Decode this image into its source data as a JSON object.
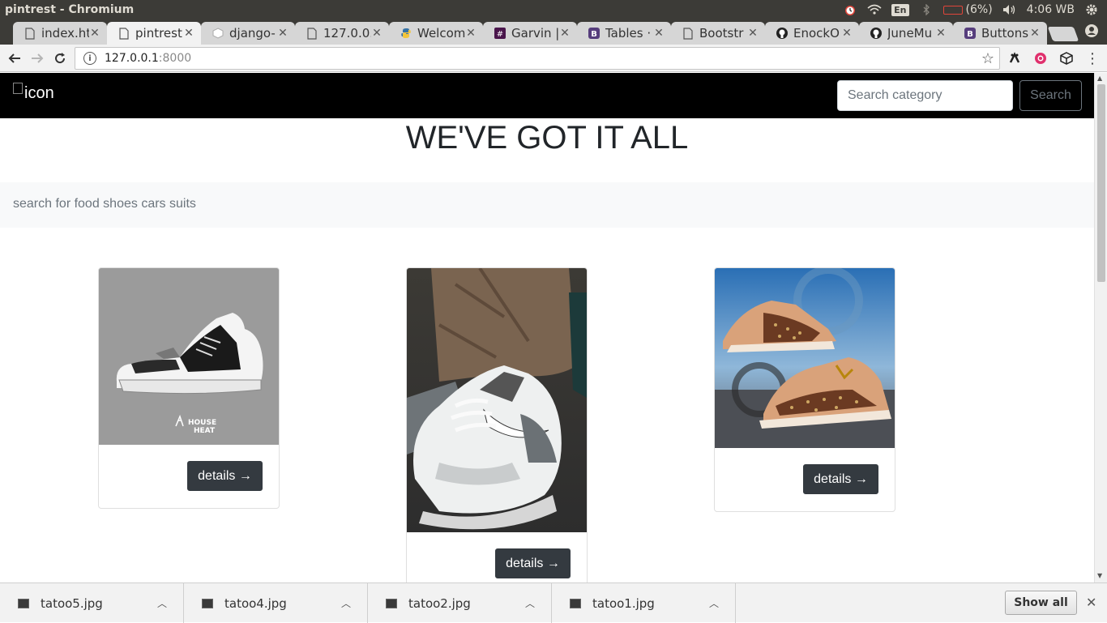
{
  "os": {
    "window_title": "pintrest - Chromium",
    "language": "En",
    "battery": "(6%)",
    "clock": "4:06 WB"
  },
  "tabs": [
    {
      "label": "index.ht",
      "icon": "page-icon",
      "active": false
    },
    {
      "label": "pintrest",
      "icon": "page-icon",
      "active": true
    },
    {
      "label": "django-",
      "icon": "cube-icon",
      "active": false
    },
    {
      "label": "127.0.0.",
      "icon": "page-icon",
      "active": false
    },
    {
      "label": "Welcom",
      "icon": "python-icon",
      "active": false
    },
    {
      "label": "Garvin |",
      "icon": "slack-icon",
      "active": false
    },
    {
      "label": "Tables ·",
      "icon": "bootstrap-icon",
      "active": false
    },
    {
      "label": "Bootstr",
      "icon": "page-icon",
      "active": false
    },
    {
      "label": "EnockO",
      "icon": "github-icon",
      "active": false
    },
    {
      "label": "JuneMu",
      "icon": "github-icon",
      "active": false
    },
    {
      "label": "Buttons",
      "icon": "bootstrap-icon",
      "active": false
    }
  ],
  "address": {
    "host": "127.0.0.1",
    "port": ":8000"
  },
  "site": {
    "brand_alt": "icon",
    "search_placeholder": "Search category",
    "search_button": "Search",
    "headline": "WE'VE GOT IT ALL",
    "subtext": "search for food shoes cars suits"
  },
  "cards": [
    {
      "image": "white-black-sneaker-photo",
      "button": "details →"
    },
    {
      "image": "grey-white-running-shoe-photo",
      "button": "details →"
    },
    {
      "image": "tan-monogram-sneakers-photo",
      "button": "details →"
    }
  ],
  "downloads": {
    "items": [
      "tatoo5.jpg",
      "tatoo4.jpg",
      "tatoo2.jpg",
      "tatoo1.jpg"
    ],
    "show_all": "Show all"
  },
  "colors": {
    "navbar": "#000000",
    "button_dark": "#343a40",
    "subbar": "#f8f9fa"
  }
}
